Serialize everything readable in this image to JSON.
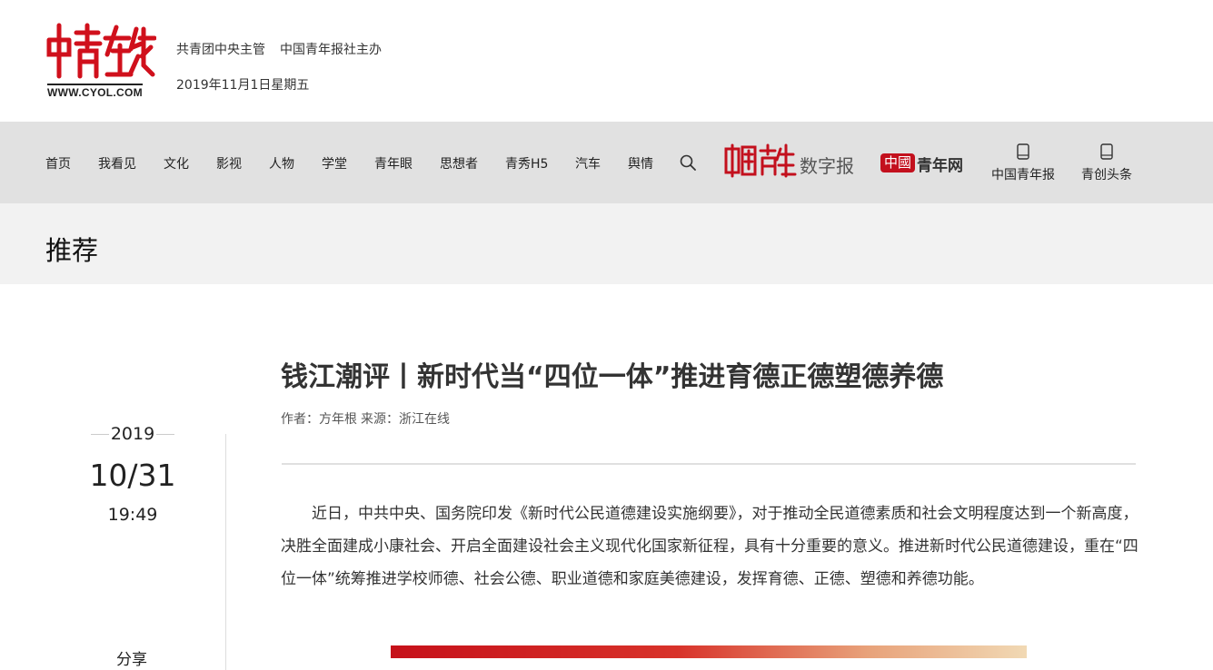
{
  "header": {
    "logo_alt": "中青在线",
    "logo_url": "WWW.CYOL.COM",
    "sponsor_1": "共青团中央主管",
    "sponsor_2": "中国青年报社主办",
    "date": "2019年11月1日星期五"
  },
  "nav": {
    "items": [
      "首页",
      "我看见",
      "文化",
      "影视",
      "人物",
      "学堂",
      "青年眼",
      "思想者",
      "青秀H5",
      "汽车",
      "舆情"
    ],
    "brand_digital_label": "数字报",
    "brand_cy_badge": "中國",
    "brand_cy_label": "青年网",
    "apps": [
      {
        "label": "中国青年报",
        "icon": "tablet-icon"
      },
      {
        "label": "青创头条",
        "icon": "tablet-icon"
      }
    ]
  },
  "section": {
    "title": "推荐"
  },
  "article": {
    "title": "钱江潮评丨新时代当“四位一体”推进育德正德塑德养德",
    "author": "作者：方年根",
    "source": "来源：浙江在线",
    "year": "2019",
    "month_day": "10/31",
    "time": "19:49",
    "share_label": "分享",
    "body": "近日，中共中央、国务院印发《新时代公民道德建设实施纲要》，对于推动全民道德素质和社会文明程度达到一个新高度，决胜全面建成小康社会、开启全面建设社会主义现代化国家新征程，具有十分重要的意义。推进新时代公民道德建设，重在“四位一体”统筹推进学校师德、社会公德、职业道德和家庭美德建设，发挥育德、正德、塑德和养德功能。"
  },
  "colors": {
    "brand_red": "#c3101d",
    "nav_bg": "#e1e1e1",
    "band_bg": "#f2f2f2"
  }
}
